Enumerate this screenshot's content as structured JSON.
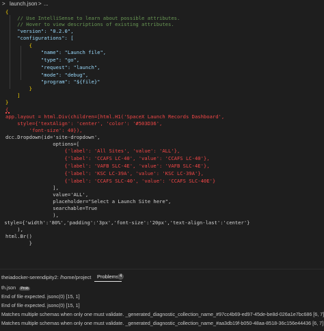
{
  "breadcrumb": {
    "folder": ">",
    "file": "launch.json",
    "sep": ">",
    "rest": "..."
  },
  "editor": {
    "json_lines": [
      "{",
      "    // Use IntelliSense to learn about possible attributes.",
      "    // Hover to view descriptions of existing attributes.",
      "    \"version\": \"0.2.0\",",
      "    \"configurations\": [",
      "        {",
      "            \"name\": \"Launch file\",",
      "            \"type\": \"go\",",
      "            \"request\": \"launch\",",
      "            \"mode\": \"debug\",",
      "            \"program\": \"${file}\"",
      "        }",
      "    ]",
      "}"
    ],
    "python_lines": [
      "{",
      "app.layout = html.Div(children=[html.H1('SpaceX Launch Records Dashboard',",
      "    style={'textAlign': 'center', 'color': '#503D36',",
      "        'font-size': 40}),",
      "dcc.Dropdown(id='site-dropdown',",
      "                options=[",
      "                    {'label': 'All Sites', 'value': 'ALL'},",
      "                    {'label': 'CCAFS LC-40', 'value': 'CCAFS LC-40'},",
      "                    {'label': 'VAFB SLC-4E', 'value': 'VAFB SLC-4E'},",
      "                    {'label': 'KSC LC-39A', 'value': 'KSC LC-39A'},",
      "                    {'label': 'CCAFS SLC-40', 'value': 'CCAFS SLC-40E'}",
      "                ],",
      "                value='ALL',",
      "                placeholder=\"Select a Launch Site here\",",
      "                searchable=True",
      "                ),",
      " style={'width':'80%','padding':'3px','font-size':'20px','text-align-last':'center'}",
      "    ),",
      "html.Br()",
      "        }"
    ]
  },
  "panel": {
    "path": "theiadocker-serendipity2: /home/project",
    "tab_label": "Problems",
    "tab_count": "4",
    "file_label": "th.json",
    "file_tag": "Prob",
    "problems": [
      "End of file expected.  jsonc(0)  [15, 1]",
      "End of file expected.  jsonc(0)  [15, 1]",
      "Matches multiple schemas when only one must validate.  _generated_diagnostic_collection_name_#97cc4b69-ed97-45de-be8d-026a1e7bc686  [6, 7]",
      "Matches multiple schemas when only one must validate.  _generated_diagnostic_collection_name_#aa3db19f-b050-48aa-8518-36c156e44436  [6, 7]"
    ]
  },
  "colors": {
    "background": "#1e1e1e",
    "comment": "#6a9955",
    "key": "#9cdcfe",
    "string": "#ce9178",
    "error": "#f44747"
  }
}
